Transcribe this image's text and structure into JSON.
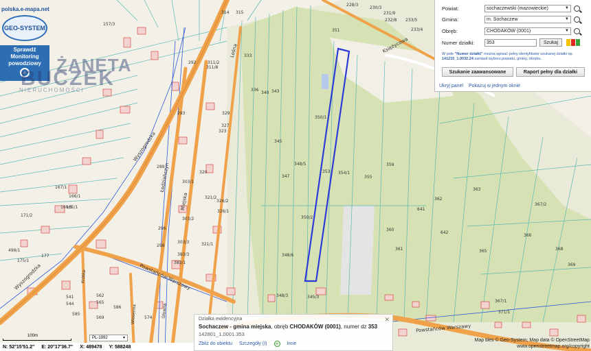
{
  "brand": {
    "site": "polska.e-mapa.net",
    "logo": "GEO-SYSTEM",
    "flood_lines": [
      "Sprawdź",
      "Monitoring",
      "powodziowy"
    ],
    "watermark_top": "ŻANETA",
    "watermark_main": "BUCZEK",
    "watermark_sub": "NIERUCHOMOŚCI"
  },
  "panel": {
    "powiat_label": "Powiat:",
    "powiat_value": "sochaczewski (mazowieckie)",
    "gmina_label": "Gmina:",
    "gmina_value": "m. Sochaczew",
    "obreb_label": "Obręb:",
    "obreb_value": "CHODAKÓW (0001)",
    "numer_label": "Numer działki:",
    "numer_value": "353",
    "search_label": "Szukaj",
    "hint_a": "W pole",
    "hint_b": "\"Numer działki\"",
    "hint_c": "można wpisać pełny identyfikator szukanej działki np.",
    "hint_d": "141215_1.0032.24",
    "hint_e": "zamiast wyboru powiatu, gminy, obrębu.",
    "advanced_label": "Szukanie zaawansowane",
    "report_label": "Raport pełny dla działki",
    "hide_label": "Ukryj panel",
    "window_label": "Pokazuj w jednym oknie",
    "legend_colors": [
      "#f5c400",
      "#e0281e",
      "#3aa33a"
    ]
  },
  "info": {
    "title": "Działka ewidencyjna",
    "place": "Sochaczew - gmina miejska",
    "obreb_text": ", obręb",
    "obreb_name": "CHODAKÓW (0001)",
    "numer_text": ", numer dz",
    "numer": "353",
    "id": "142801_1.0001.353",
    "zoom_link": "Zbliż do obiektu",
    "details_link": "Szczegóły (I)",
    "other_link": "Inne"
  },
  "status": {
    "scale": "100m",
    "projection": "PL-1992",
    "lat": "N: 52°15'51.2\"",
    "lon": "E: 20°17'36.7\"",
    "x": "X: 489478",
    "y": "Y: 588248"
  },
  "attribution": {
    "line1": "Map tiles © Geo-System; Map data © OpenStreetMap",
    "line2": "www.openstreetmap.org/copyright"
  },
  "map": {
    "streets": [
      "Księżycowa",
      "Wyszogrodzka",
      "Wyszogrodzka",
      "Leśna",
      "Miejska",
      "Łodziańczyn",
      "Powstańców Warszawy",
      "Powstańców Warszawy",
      "Krótka",
      "Wiosenna",
      "Głowna"
    ],
    "parcels": [
      "333",
      "336",
      "340",
      "343",
      "345",
      "347",
      "348/5",
      "348/6",
      "350/1",
      "350/2",
      "353",
      "354/1",
      "355",
      "359",
      "361",
      "360",
      "362",
      "363",
      "365",
      "366",
      "367/2",
      "368",
      "369",
      "641",
      "642",
      "314",
      "315",
      "311/2",
      "311/8",
      "292",
      "293",
      "289",
      "298",
      "296",
      "320",
      "321/1",
      "321/2",
      "323",
      "326/2",
      "326/1",
      "329",
      "327",
      "303/2",
      "303/3",
      "303/1",
      "383/3",
      "383/1",
      "157/3",
      "165/1",
      "166/1",
      "167/1",
      "169/5",
      "171/2",
      "175/1",
      "177",
      "499/1",
      "562",
      "565",
      "569",
      "585",
      "586",
      "574",
      "541",
      "544",
      "345/3",
      "348/3",
      "367/1",
      "371/1",
      "228/3",
      "230/3",
      "231/9",
      "232/8",
      "233/5",
      "233/4",
      "351"
    ],
    "accent": "#2c3ad6"
  }
}
